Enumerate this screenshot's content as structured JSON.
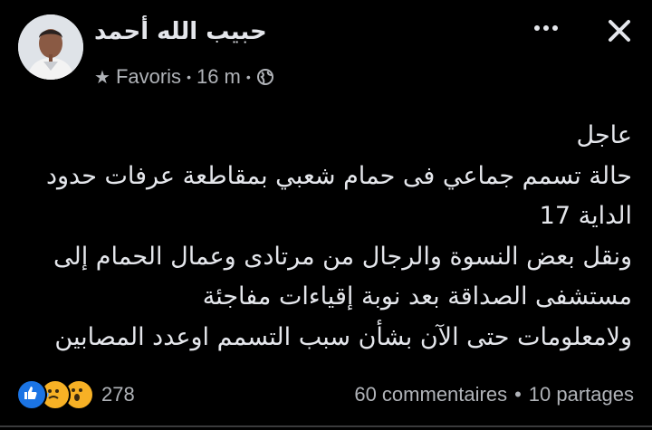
{
  "author": {
    "name": "حبيب الله أحمد"
  },
  "meta": {
    "visibility_label": "Favoris",
    "separator": "•",
    "time": "16 m",
    "separator2": "•"
  },
  "icons": {
    "more": "more-dots-icon",
    "close": "close-icon",
    "star": "star-icon",
    "globe": "globe-icon"
  },
  "post": {
    "lines": [
      "عاجل",
      "حالة تسمم جماعي فى حمام شعبي بمقاطعة عرفات حدود",
      "الداية 17",
      "ونقل بعض النسوة والرجال من مرتادى وعمال  الحمام إلى",
      "مستشفى الصداقة بعد نوبة إقياءات مفاجئة",
      "ولامعلومات حتى الآن بشأن سبب التسمم اوعدد المصابين"
    ]
  },
  "footer": {
    "reaction_count": "278",
    "reactions": [
      "like",
      "sad",
      "wow"
    ],
    "comments": "60 commentaires",
    "separator": "•",
    "shares": "10 partages"
  },
  "colors": {
    "background": "#000000",
    "text": "#e4e6eb",
    "secondary": "#b0b3b8",
    "like_blue": "#1b74e4",
    "emoji_yellow": "#f7b125"
  }
}
